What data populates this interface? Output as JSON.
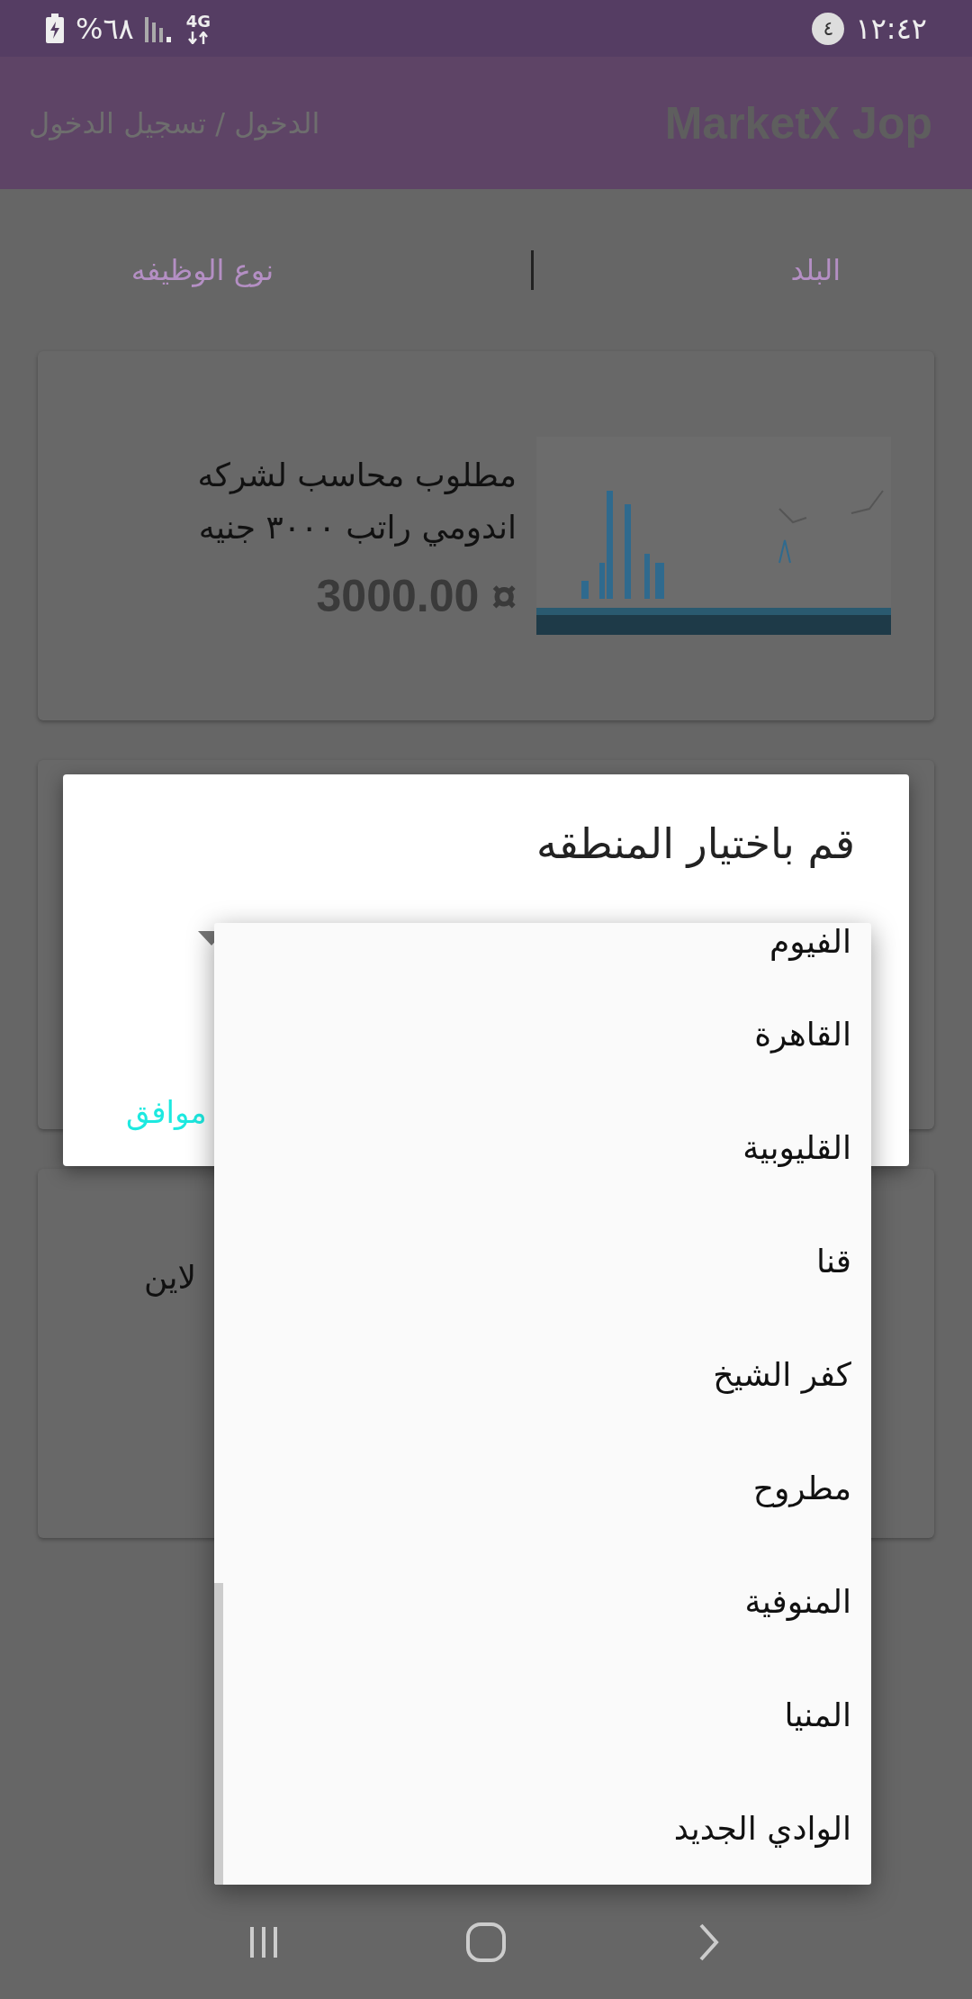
{
  "status_bar": {
    "battery": "%٦٨",
    "network": "4G",
    "time": "١٢:٤٢",
    "notification_count": "٤"
  },
  "app_bar": {
    "title": "MarketX Jop",
    "login_link": "الدخول / تسجيل الدخول"
  },
  "filters": [
    {
      "label": "البلد"
    },
    {
      "label": "نوع الوظيفه"
    }
  ],
  "cards": [
    {
      "kind": "job",
      "title": "مطلوب محاسب لشركه اندومي راتب ٣٠٠٠ جنيه",
      "price": "3000.00",
      "currency": "¤"
    },
    {
      "kind": "empty"
    },
    {
      "kind": "partial",
      "text": "لاين"
    }
  ],
  "dialog": {
    "title": "قم باختيار المنطقه",
    "ok_button": "موافق"
  },
  "dropdown": {
    "items": [
      "الفيوم",
      "القاهرة",
      "القليوبية",
      "قنا",
      "كفر الشيخ",
      "مطروح",
      "المنوفية",
      "المنيا",
      "الوادي الجديد"
    ]
  }
}
